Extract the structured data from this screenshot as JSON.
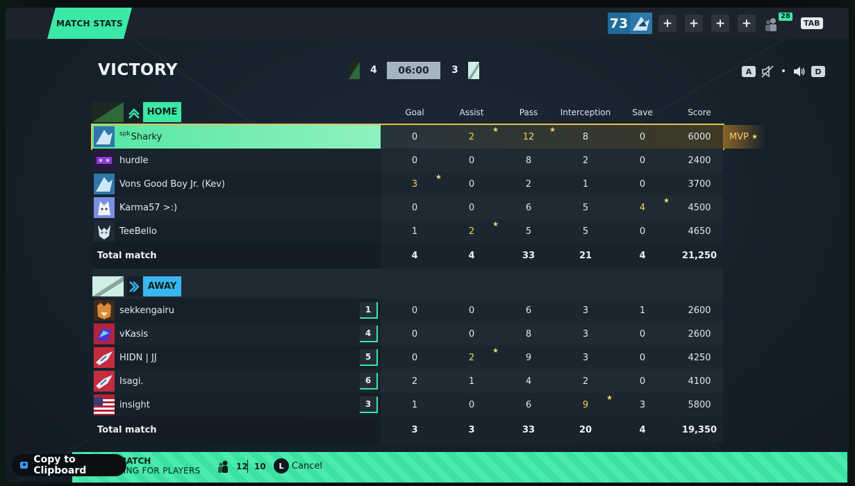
{
  "header": {
    "title": "MATCH STATS",
    "rating": "73",
    "friends_count": "28",
    "tab_key": "TAB",
    "plus_label": "+"
  },
  "result": {
    "outcome": "VICTORY",
    "home_score": "4",
    "timer": "06:00",
    "away_score": "3"
  },
  "audio": {
    "left_key": "A",
    "right_key": "D"
  },
  "columns": [
    "Goal",
    "Assist",
    "Pass",
    "Interception",
    "Save",
    "Score"
  ],
  "home": {
    "label": "HOME",
    "players": [
      {
        "tag": "spk",
        "name": "Sharky",
        "stats": [
          "0",
          "2",
          "12",
          "8",
          "0",
          "6000"
        ]
      },
      {
        "tag": "",
        "name": "hurdle",
        "stats": [
          "0",
          "0",
          "8",
          "2",
          "0",
          "2400"
        ]
      },
      {
        "tag": "",
        "name": "Vons Good Boy Jr. (Kev)",
        "stats": [
          "3",
          "0",
          "2",
          "1",
          "0",
          "3700"
        ]
      },
      {
        "tag": "",
        "name": "Karma57 >:)",
        "stats": [
          "0",
          "0",
          "6",
          "5",
          "4",
          "4500"
        ]
      },
      {
        "tag": "",
        "name": "TeeBello",
        "stats": [
          "1",
          "2",
          "5",
          "5",
          "0",
          "4650"
        ]
      }
    ],
    "total_label": "Total match",
    "totals": [
      "4",
      "4",
      "33",
      "21",
      "4",
      "21,250"
    ]
  },
  "mvp_label": "MVP",
  "away": {
    "label": "AWAY",
    "players": [
      {
        "name": "sekkengairu",
        "rank": "1",
        "stats": [
          "0",
          "0",
          "6",
          "3",
          "1",
          "2600"
        ]
      },
      {
        "name": "vKasis",
        "rank": "4",
        "stats": [
          "0",
          "0",
          "8",
          "3",
          "0",
          "2600"
        ]
      },
      {
        "name": "HIDN | JJ",
        "rank": "5",
        "stats": [
          "0",
          "2",
          "9",
          "3",
          "0",
          "4250"
        ]
      },
      {
        "name": "Isagi.",
        "rank": "6",
        "stats": [
          "2",
          "1",
          "4",
          "2",
          "0",
          "4100"
        ]
      },
      {
        "name": "insight",
        "rank": "3",
        "stats": [
          "1",
          "0",
          "6",
          "9",
          "3",
          "5800"
        ]
      }
    ],
    "total_label": "Total match",
    "totals": [
      "3",
      "3",
      "33",
      "20",
      "4",
      "19,350"
    ]
  },
  "bottom": {
    "line1": "MATCH",
    "line2": "TING FOR PLAYERS",
    "players_current": "12",
    "players_max": "10",
    "cancel_key": "L",
    "cancel_label": "Cancel",
    "clipboard_label": "Copy to Clipboard"
  },
  "colors": {
    "accent": "#3ce8a6",
    "away_accent": "#38b6f0",
    "highlight": "#f0d25a",
    "mvp_border": "#e8c24a"
  }
}
